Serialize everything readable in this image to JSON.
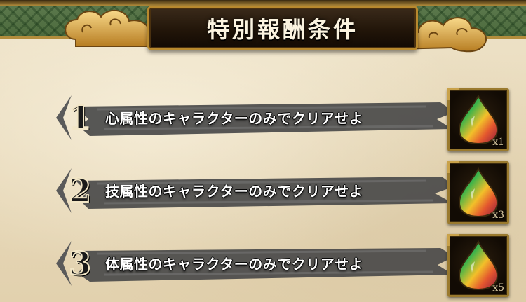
{
  "title": "特別報酬条件",
  "conditions": [
    {
      "number": "1",
      "text": "心属性のキャラクターのみでクリアせよ",
      "reward_qty": "x1"
    },
    {
      "number": "2",
      "text": "技属性のキャラクターのみでクリアせよ",
      "reward_qty": "x3"
    },
    {
      "number": "3",
      "text": "体属性のキャラクターのみでクリアせよ",
      "reward_qty": "x5"
    }
  ],
  "reward_icon": "rainbow-gem-icon",
  "colors": {
    "banner_border": "#b8892e",
    "parchment": "#e9dcc0",
    "brush": "#4a4a4a"
  }
}
